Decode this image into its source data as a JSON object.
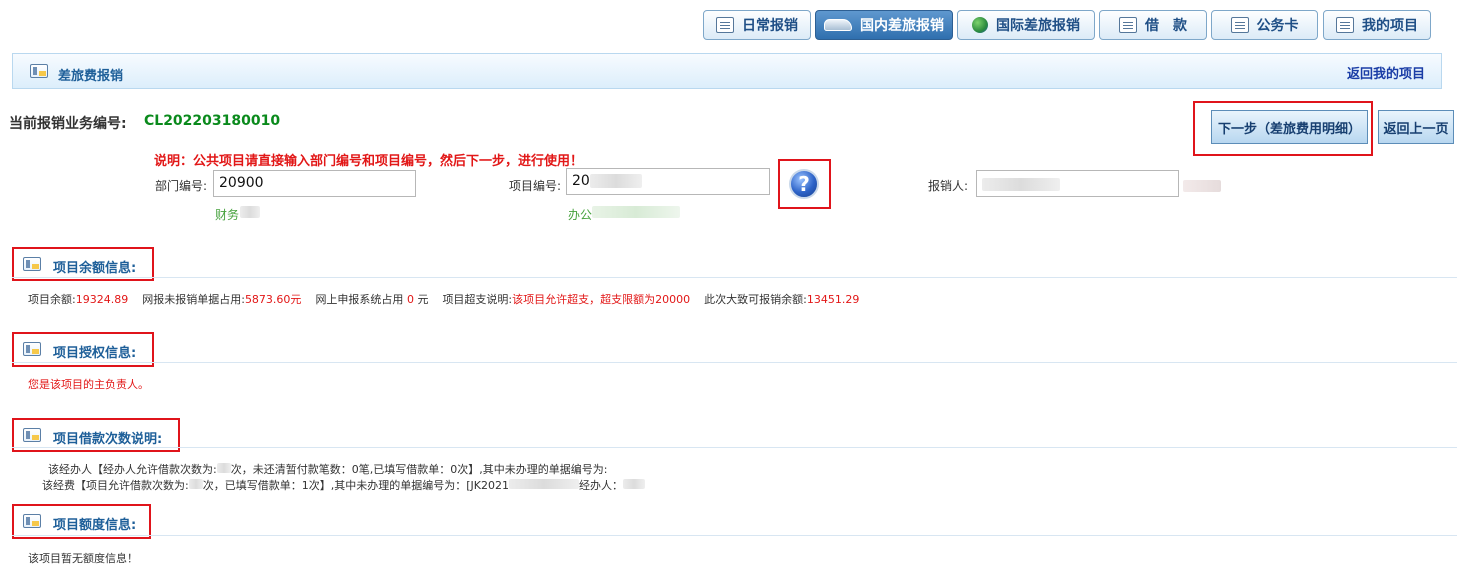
{
  "tabs": [
    {
      "label": "日常报销",
      "icon": "document-icon",
      "active": false
    },
    {
      "label": "国内差旅报销",
      "icon": "train-icon",
      "active": true
    },
    {
      "label": "国际差旅报销",
      "icon": "globe-icon",
      "active": false
    },
    {
      "label": "借　款",
      "icon": "cash-icon",
      "active": false
    },
    {
      "label": "公务卡",
      "icon": "card-icon",
      "active": false
    },
    {
      "label": "我的项目",
      "icon": "list-icon",
      "active": false
    }
  ],
  "header": {
    "title": "差旅费报销",
    "back_link": "返回我的项目"
  },
  "business": {
    "label": "当前报销业务编号:",
    "code": "CL202203180010"
  },
  "buttons": {
    "next": "下一步（差旅费用明细）",
    "back": "返回上一页"
  },
  "note": "说明：公共项目请直接输入部门编号和项目编号，然后下一步，进行使用！",
  "form": {
    "dept_label": "部门编号:",
    "dept_value": "20900",
    "dept_hint": "财务",
    "project_label": "项目编号:",
    "project_value": "202",
    "project_hint": "办公",
    "claimant_label": "报销人:",
    "help_symbol": "?"
  },
  "balance": {
    "title": "项目余额信息:",
    "balance_label": "项目余额:",
    "balance_value": "19324.89",
    "pending_label": "网报未报销单据占用:",
    "pending_value": "5873.60元",
    "online_label": "网上申报系统占用",
    "online_value": "0",
    "online_unit": "元",
    "overdraft_label": "项目超支说明:",
    "overdraft_value": "该项目允许超支，超支限额为20000",
    "available_label": "此次大致可报销余额:",
    "available_value": "13451.29"
  },
  "authorization": {
    "title": "项目授权信息:",
    "text": "您是该项目的主负责人。"
  },
  "loan": {
    "title": "项目借款次数说明:",
    "line1": "该经办人【经办人允许借款次数为:",
    "line1b": "次，未还清暂付款笔数：0笔,已填写借款单：0次】,其中未办理的单据编号为:",
    "line2": "该经费【项目允许借款次数为:",
    "line2b": "次，已填写借款单：1次】,其中未办理的单据编号为：[JK2021",
    "line2c": "经办人："
  },
  "quota": {
    "title": "项目额度信息:",
    "text": "该项目暂无额度信息！"
  },
  "colors": {
    "accent": "#1e5f99",
    "highlight": "#e0141b",
    "success": "#0a8a1c"
  }
}
